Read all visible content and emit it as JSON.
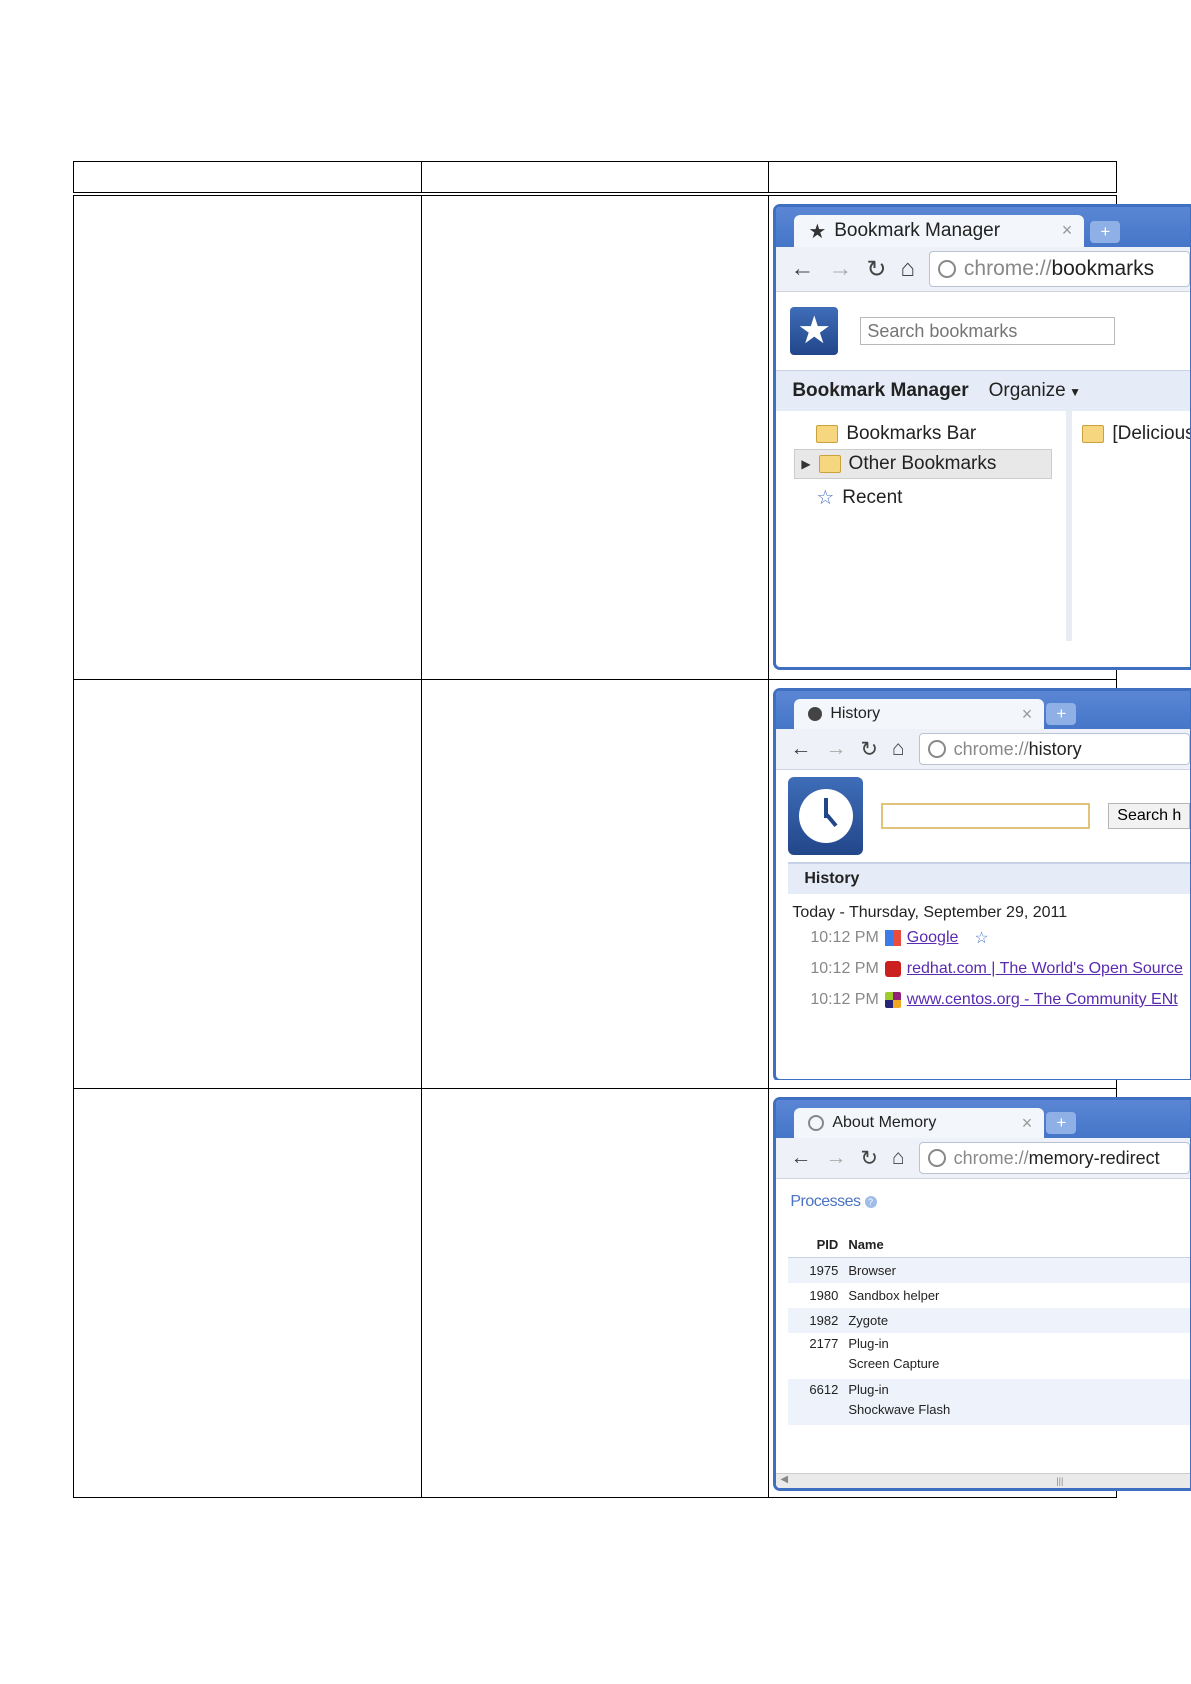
{
  "bookmarks": {
    "tab_title": "Bookmark Manager",
    "url_scheme": "chrome://",
    "url_host": "bookmarks",
    "search_placeholder": "Search bookmarks",
    "heading": "Bookmark Manager",
    "organize": "Organize",
    "tree": [
      "Bookmarks Bar",
      "Other Bookmarks",
      "Recent"
    ],
    "right_item": "[Delicious"
  },
  "history": {
    "tab_title": "History",
    "url_scheme": "chrome://",
    "url_host": "history",
    "search_button": "Search h",
    "heading": "History",
    "date": "Today - Thursday, September 29, 2011",
    "entries": [
      {
        "time": "10:12 PM",
        "title": "Google"
      },
      {
        "time": "10:12 PM",
        "title": "redhat.com | The World's Open Source"
      },
      {
        "time": "10:12 PM",
        "title": "www.centos.org - The Community ENt"
      }
    ]
  },
  "memory": {
    "tab_title": "About Memory",
    "url_scheme": "chrome://",
    "url_host": "memory-redirect",
    "processes_label": "Processes",
    "col_pid": "PID",
    "col_name": "Name",
    "rows": [
      {
        "pid": "1975",
        "name": "Browser",
        "sub": ""
      },
      {
        "pid": "1980",
        "name": "Sandbox helper",
        "sub": ""
      },
      {
        "pid": "1982",
        "name": "Zygote",
        "sub": ""
      },
      {
        "pid": "2177",
        "name": "Plug-in",
        "sub": "Screen Capture"
      },
      {
        "pid": "6612",
        "name": "Plug-in",
        "sub": "Shockwave Flash"
      }
    ]
  }
}
